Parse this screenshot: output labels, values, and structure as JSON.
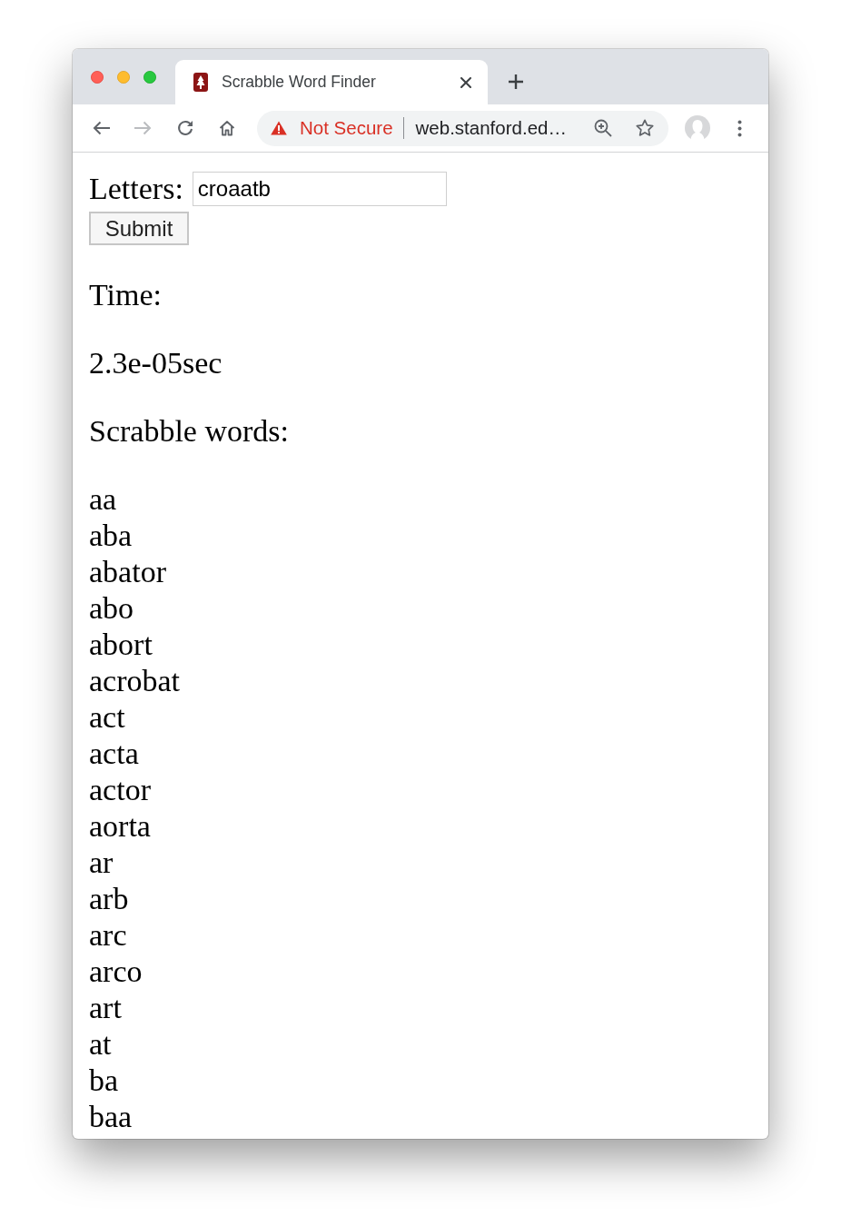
{
  "tabs": [
    {
      "title": "Scrabble Word Finder",
      "selected": true
    }
  ],
  "navigation": {
    "back": {
      "disabled": false
    },
    "forward": {
      "disabled": true
    }
  },
  "address_bar": {
    "security_label": "Not Secure",
    "url": "web.stanford.ed…"
  },
  "form": {
    "label": "Letters:",
    "value": "croaatb",
    "submit": "Submit"
  },
  "time": {
    "label": "Time:",
    "value": "2.3e-05sec"
  },
  "results": {
    "label": "Scrabble words:",
    "words": [
      "aa",
      "aba",
      "abator",
      "abo",
      "abort",
      "acrobat",
      "act",
      "acta",
      "actor",
      "aorta",
      "ar",
      "arb",
      "arc",
      "arco",
      "art",
      "at",
      "ba",
      "baa"
    ]
  }
}
